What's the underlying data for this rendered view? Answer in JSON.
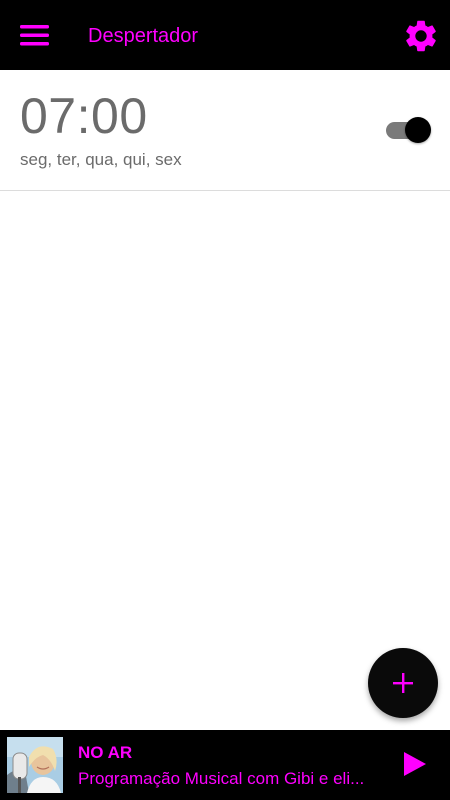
{
  "colors": {
    "accent": "#ff00ff",
    "bar_background": "#000000",
    "text_gray": "#6b6b6b",
    "toggle_track": "#7a7a7a"
  },
  "header": {
    "title": "Despertador",
    "menu_icon": "hamburger-menu-icon",
    "settings_icon": "gear-icon"
  },
  "alarms": [
    {
      "time": "07:00",
      "days": "seg, ter, qua, qui, sex",
      "enabled": true
    }
  ],
  "fab": {
    "icon": "plus-icon"
  },
  "player": {
    "status": "NO AR",
    "program": "Programação Musical com Gibi e eli...",
    "play_icon": "play-icon"
  }
}
